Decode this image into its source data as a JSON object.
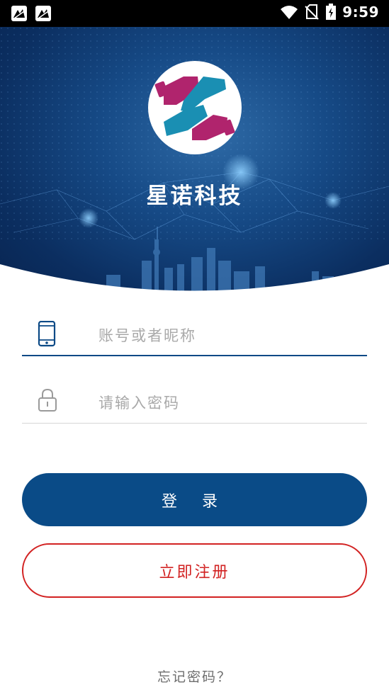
{
  "status_bar": {
    "time": "9:59",
    "icons": [
      "notification-icon",
      "notification-icon",
      "wifi-icon",
      "no-sim-icon",
      "battery-charging-icon"
    ]
  },
  "brand": {
    "name": "星诺科技",
    "logo_colors": {
      "magenta": "#b0246d",
      "teal": "#1a8fb3"
    }
  },
  "form": {
    "account_placeholder": "账号或者昵称",
    "password_placeholder": "请输入密码",
    "account_icon": "phone-icon",
    "password_icon": "lock-icon"
  },
  "buttons": {
    "login_label": "登 录",
    "register_label": "立即注册"
  },
  "links": {
    "forgot_password": "忘记密码？"
  },
  "colors": {
    "primary": "#0a4b87",
    "register": "#d22222",
    "hero_dark": "#082450"
  }
}
